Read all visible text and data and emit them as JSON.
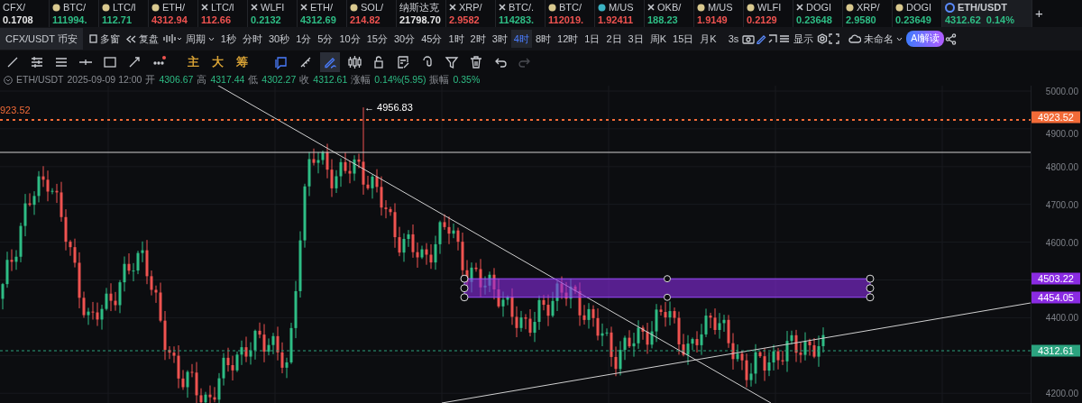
{
  "tickers": [
    {
      "symbol": "CFX/",
      "price": "0.1708",
      "color": "#e6e6e6",
      "selected": false
    },
    {
      "symbol": "BTC/",
      "price": "111994.",
      "color": "#2ebd85",
      "selected": false
    },
    {
      "symbol": "LTC/l",
      "price": "112.71",
      "color": "#2ebd85",
      "selected": false
    },
    {
      "symbol": "ETH/",
      "price": "4312.94",
      "color": "#ef5350",
      "selected": false
    },
    {
      "symbol": "LTC/l",
      "price": "112.66",
      "color": "#ef5350",
      "selected": false
    },
    {
      "symbol": "WLFI",
      "price": "0.2132",
      "color": "#2ebd85",
      "selected": false
    },
    {
      "symbol": "ETH/",
      "price": "4312.69",
      "color": "#2ebd85",
      "selected": false
    },
    {
      "symbol": "SOL/",
      "price": "214.82",
      "color": "#ef5350",
      "selected": false
    },
    {
      "symbol": "纳斯达克",
      "price": "21798.70",
      "color": "#e6e6e6",
      "selected": false
    },
    {
      "symbol": "XRP/",
      "price": "2.9582",
      "color": "#ef5350",
      "selected": false
    },
    {
      "symbol": "BTC/.",
      "price": "114283.",
      "color": "#2ebd85",
      "selected": false
    },
    {
      "symbol": "BTC/",
      "price": "112019.",
      "color": "#ef5350",
      "selected": false
    },
    {
      "symbol": "M/US",
      "price": "1.92411",
      "color": "#ef5350",
      "selected": false
    },
    {
      "symbol": "OKB/",
      "price": "188.23",
      "color": "#2ebd85",
      "selected": false
    },
    {
      "symbol": "M/US",
      "price": "1.9149",
      "color": "#ef5350",
      "selected": false
    },
    {
      "symbol": "WLFI",
      "price": "0.2129",
      "color": "#ef5350",
      "selected": false
    },
    {
      "symbol": "DOGI",
      "price": "0.23648",
      "color": "#2ebd85",
      "selected": false
    },
    {
      "symbol": "XRP/",
      "price": "2.9580",
      "color": "#2ebd85",
      "selected": false
    },
    {
      "symbol": "DOGI",
      "price": "0.23649",
      "color": "#2ebd85",
      "selected": false
    },
    {
      "symbol": "ETH/USDT",
      "price": "4312.62",
      "change": "0.14%",
      "color": "#2ebd85",
      "selected": true
    }
  ],
  "add_tab": "+",
  "toolbar": {
    "market_tab": "CFX/USDT 币安",
    "multi_window": "多窗",
    "replay": "复盘",
    "period": "周期",
    "intervals": [
      {
        "label": "1秒",
        "selected": false
      },
      {
        "label": "分时",
        "selected": false
      },
      {
        "label": "30秒",
        "selected": false
      },
      {
        "label": "1分",
        "selected": false
      },
      {
        "label": "5分",
        "selected": false
      },
      {
        "label": "10分",
        "selected": false
      },
      {
        "label": "15分",
        "selected": false
      },
      {
        "label": "30分",
        "selected": false
      },
      {
        "label": "45分",
        "selected": false
      },
      {
        "label": "1时",
        "selected": false
      },
      {
        "label": "2时",
        "selected": false
      },
      {
        "label": "3时",
        "selected": false
      },
      {
        "label": "4时",
        "selected": true
      },
      {
        "label": "8时",
        "selected": false
      },
      {
        "label": "12时",
        "selected": false
      },
      {
        "label": "1日",
        "selected": false
      },
      {
        "label": "2日",
        "selected": false
      },
      {
        "label": "3日",
        "selected": false
      },
      {
        "label": "周K",
        "selected": false
      },
      {
        "label": "15日",
        "selected": false
      },
      {
        "label": "月K",
        "selected": false
      }
    ],
    "refresh": "3s",
    "display": "显示",
    "layout_name": "未命名",
    "ai_button": "AI解读"
  },
  "indicators": [
    "主",
    "大",
    "筹"
  ],
  "tools": [
    {
      "selected": false
    },
    {
      "selected": false
    },
    {
      "selected": true
    },
    {
      "selected": false
    },
    {
      "selected": false
    },
    {
      "selected": false
    },
    {
      "selected": false
    },
    {
      "selected": false
    },
    {
      "selected": false
    },
    {
      "selected": false
    },
    {
      "selected": false
    }
  ],
  "info": {
    "symbol": "ETH/USDT",
    "datetime": "2025-09-09 12:00",
    "fields": [
      {
        "label": "开",
        "value": "4306.67"
      },
      {
        "label": "高",
        "value": "4317.44"
      },
      {
        "label": "低",
        "value": "4302.27"
      },
      {
        "label": "收",
        "value": "4312.61"
      },
      {
        "label": "涨幅",
        "value": "0.14%(5.95)"
      },
      {
        "label": "振幅",
        "value": "0.35%"
      }
    ]
  },
  "chart": {
    "axis_labels": [
      "5000.00",
      "4900.00",
      "4800.00",
      "4700.00",
      "4600.00",
      "4400.00",
      "4200.00"
    ],
    "price_tags": [
      {
        "text": "4923.52",
        "color": "#f26b38"
      },
      {
        "text": "4503.22",
        "color": "#8a2be2"
      },
      {
        "text": "4454.05",
        "color": "#8a2be2"
      },
      {
        "text": "4312.61",
        "color": "#2ba37f"
      }
    ],
    "line_label": "923.52",
    "high_label": "← 4956.83"
  }
}
